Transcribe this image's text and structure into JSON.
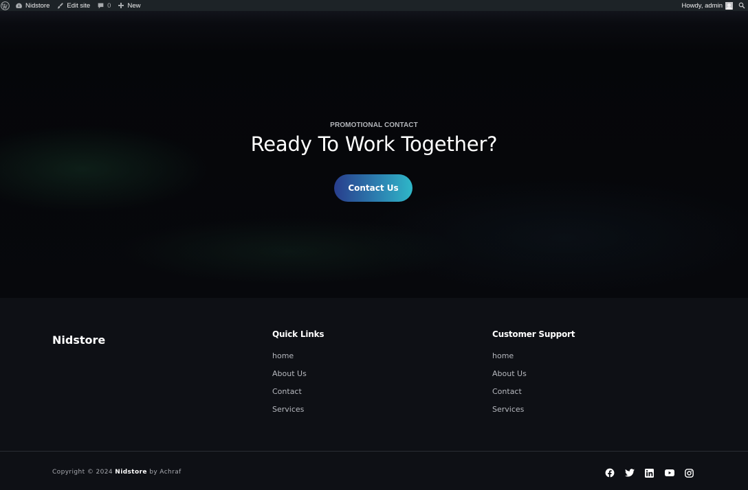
{
  "adminbar": {
    "site_name": "Nidstore",
    "edit_site": "Edit site",
    "comments_count": "0",
    "new_label": "New",
    "howdy": "Howdy, admin"
  },
  "hero": {
    "label": "PROMOTIONAL CONTACT",
    "title": "Ready To Work Together?",
    "button": "Contact Us"
  },
  "footer": {
    "brand": "Nidstore",
    "quick_links": {
      "title": "Quick Links",
      "items": [
        "home",
        "About Us",
        "Contact",
        "Services"
      ]
    },
    "support": {
      "title": "Customer Support",
      "items": [
        "home",
        "About Us",
        "Contact",
        "Services"
      ]
    },
    "copyright": {
      "prefix": "Copyright © 2024",
      "brand": "Nidstore",
      "suffix": "by Achraf"
    },
    "social": [
      "facebook-icon",
      "twitter-icon",
      "linkedin-icon",
      "youtube-icon",
      "instagram-icon"
    ]
  }
}
